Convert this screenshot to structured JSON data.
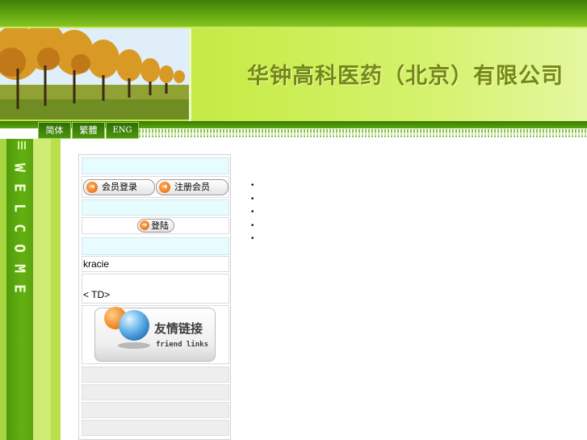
{
  "header": {
    "company_name": "华钟高科医药（北京）有限公司"
  },
  "language_tabs": [
    {
      "label": "简体"
    },
    {
      "label": "繁體"
    },
    {
      "label": "ENG"
    }
  ],
  "welcome_column": {
    "letters": [
      "W",
      "E",
      "L",
      "C",
      "O",
      "M",
      "E"
    ]
  },
  "member_panel": {
    "login_button": "会员登录",
    "register_button": "注册会员",
    "signin_button": "登陆",
    "kracie_text": "kracie",
    "td_text": "< TD>"
  },
  "friend_links": {
    "title": "友情链接",
    "subtitle": "friend links"
  },
  "main": {
    "bullets": [
      "•",
      "•",
      "•",
      "•",
      "•"
    ]
  },
  "colors": {
    "brand_green": "#5aa10f",
    "banner_light": "#d6f270",
    "company_text": "#6f8a17",
    "cyan_row": "#e7fcff",
    "arrow_orange": "#e85d00"
  },
  "icons": [
    "arrow-right-icon",
    "globe-icon",
    "tree-photo"
  ]
}
